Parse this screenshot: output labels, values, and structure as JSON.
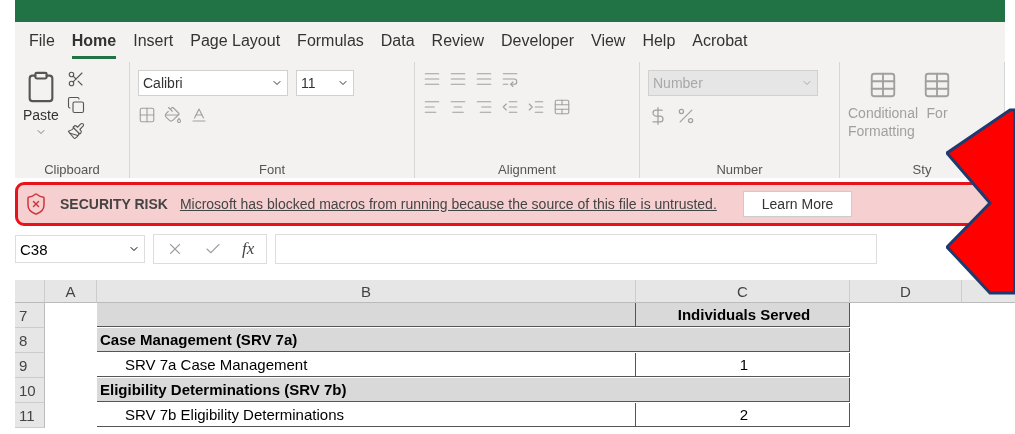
{
  "tabs": [
    {
      "label": "File",
      "selected": false
    },
    {
      "label": "Home",
      "selected": true
    },
    {
      "label": "Insert",
      "selected": false
    },
    {
      "label": "Page Layout",
      "selected": false
    },
    {
      "label": "Formulas",
      "selected": false
    },
    {
      "label": "Data",
      "selected": false
    },
    {
      "label": "Review",
      "selected": false
    },
    {
      "label": "Developer",
      "selected": false
    },
    {
      "label": "View",
      "selected": false
    },
    {
      "label": "Help",
      "selected": false
    },
    {
      "label": "Acrobat",
      "selected": false
    }
  ],
  "ribbon": {
    "paste_label": "Paste",
    "font_name": "Calibri",
    "font_size": "11",
    "number_format": "Number",
    "number_format_disabled": true,
    "conditional_formatting": [
      "Conditional",
      "Formatting"
    ],
    "format_as_table": "For",
    "groups": [
      {
        "label": "Clipboard"
      },
      {
        "label": "Font"
      },
      {
        "label": "Alignment"
      },
      {
        "label": "Number"
      },
      {
        "label": "Sty"
      }
    ]
  },
  "security_bar": {
    "title": "SECURITY RISK",
    "message": "Microsoft has blocked macros from running because the source of this file is untrusted.",
    "button": "Learn More"
  },
  "formula_bar": {
    "name_box": "C38",
    "fx": "fx"
  },
  "sheet": {
    "columns": [
      "A",
      "B",
      "C",
      "D"
    ],
    "rows": [
      {
        "number": "7",
        "kind": "header",
        "b": "",
        "c": "Individuals Served"
      },
      {
        "number": "8",
        "kind": "section",
        "b": "Case Management (SRV 7a)",
        "c": ""
      },
      {
        "number": "9",
        "kind": "item",
        "b": "SRV 7a Case Management",
        "c": "1"
      },
      {
        "number": "10",
        "kind": "section",
        "b": "Eligibility Determinations (SRV 7b)",
        "c": ""
      },
      {
        "number": "11",
        "kind": "item",
        "b": "SRV 7b Eligibility Determinations",
        "c": "2"
      }
    ]
  }
}
